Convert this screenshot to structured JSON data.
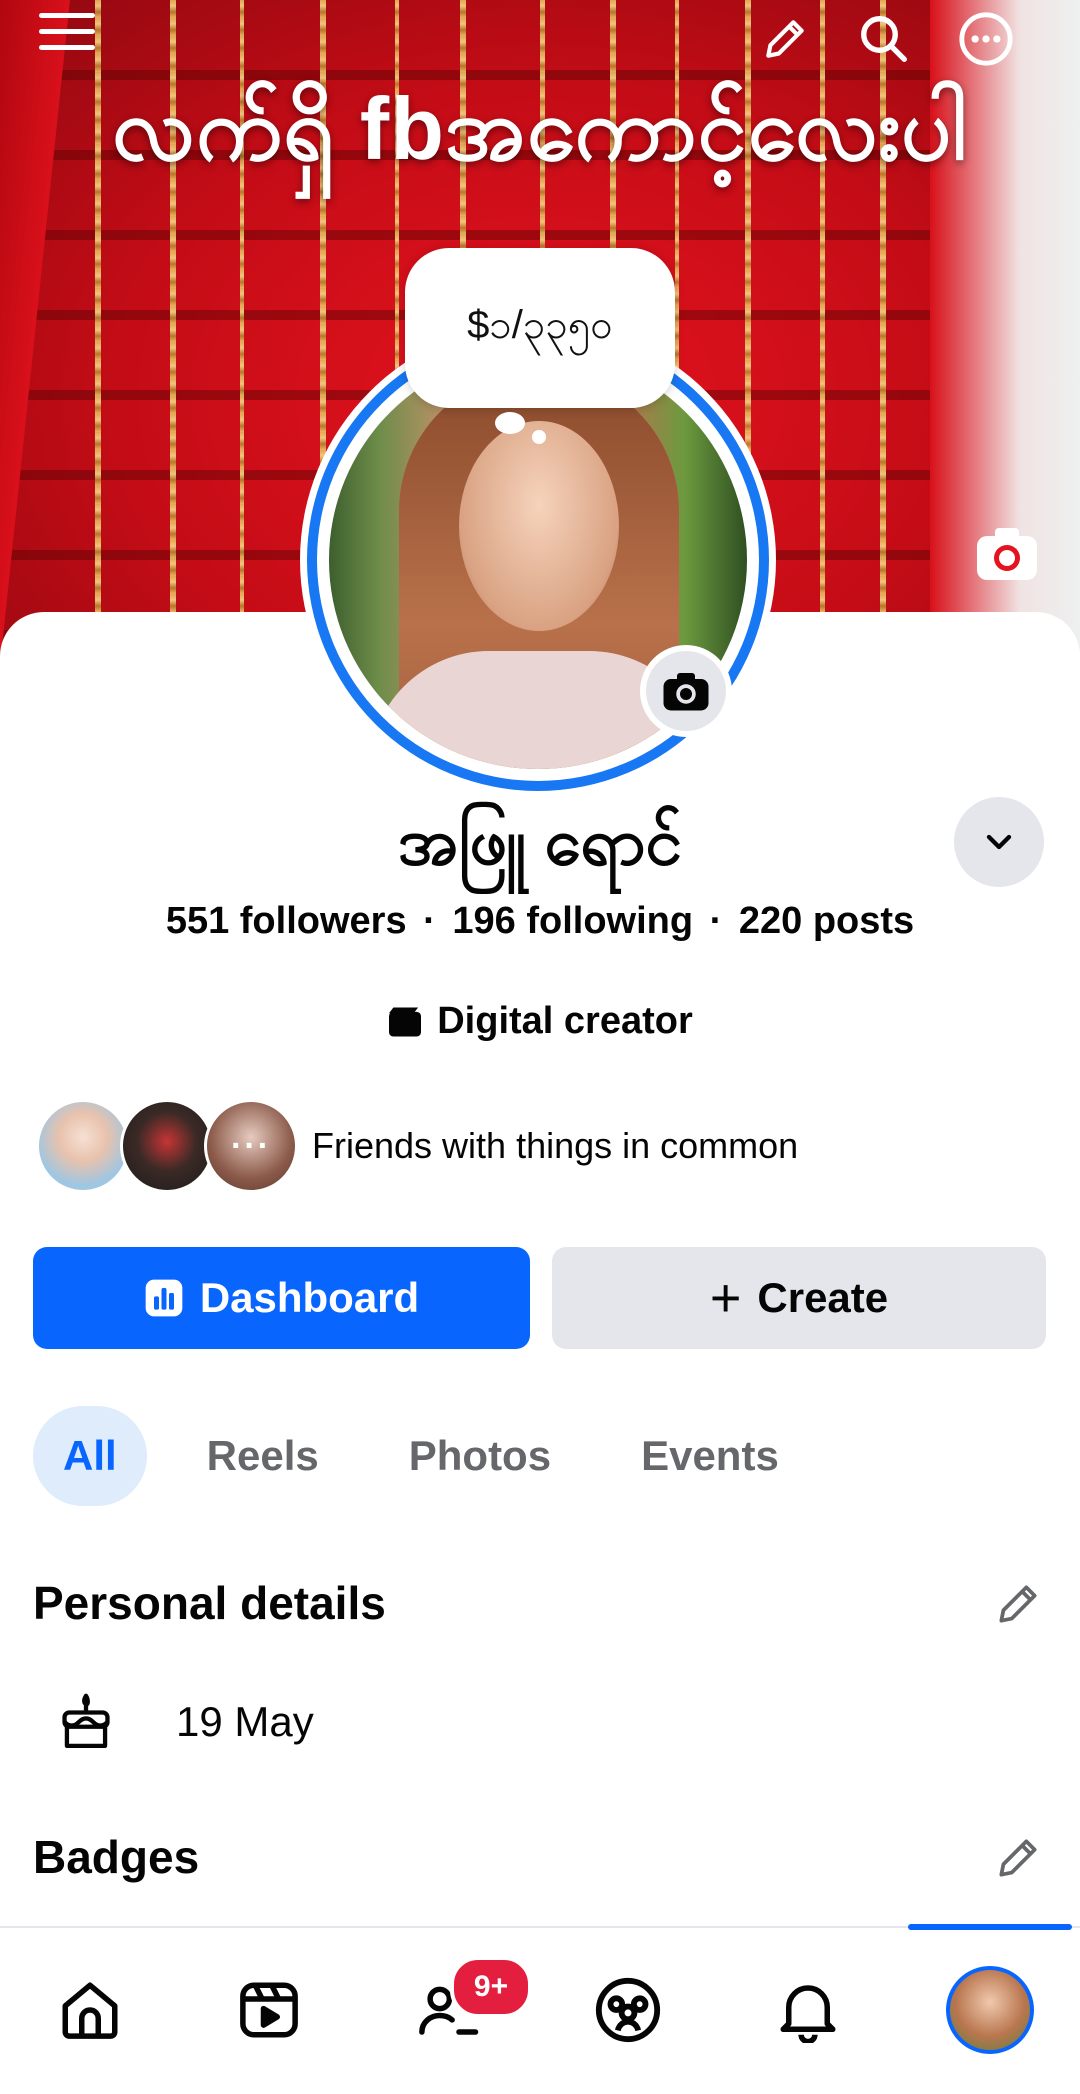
{
  "cover": {
    "title": "လက်ရှိ fbအကောင့်လေးပါ"
  },
  "top_bar": {
    "menu_icon": "hamburger-menu-icon",
    "edit_icon": "pencil-icon",
    "search_icon": "search-icon",
    "more_icon": "more-dots-icon"
  },
  "note": {
    "text": "$၁/၃၃၅၀"
  },
  "profile": {
    "name": "အဖြူ ရောင်",
    "followers": "551",
    "followers_label": "followers",
    "following": "196",
    "following_label": "following",
    "posts": "220",
    "posts_label": "posts",
    "separator": "·",
    "category": "Digital creator",
    "friends_text": "Friends with things in common",
    "friends_more": "···"
  },
  "actions": {
    "dashboard_label": "Dashboard",
    "create_label": "Create",
    "create_prefix": "+"
  },
  "tabs": [
    {
      "label": "All",
      "active": true
    },
    {
      "label": "Reels",
      "active": false
    },
    {
      "label": "Photos",
      "active": false
    },
    {
      "label": "Events",
      "active": false
    }
  ],
  "personal_details": {
    "title": "Personal details",
    "birthday": "19 May"
  },
  "badges": {
    "title": "Badges"
  },
  "bottom_nav": {
    "items": [
      "home-icon",
      "video-icon",
      "friends-icon",
      "groups-icon",
      "notifications-icon",
      "profile-avatar"
    ],
    "friends_badge": "9+"
  },
  "colors": {
    "primary": "#0866ff",
    "secondary_bg": "#e4e6eb",
    "tab_active_bg": "#dfecfb",
    "badge_red": "#e41e3f",
    "cover_red": "#d4101b"
  }
}
